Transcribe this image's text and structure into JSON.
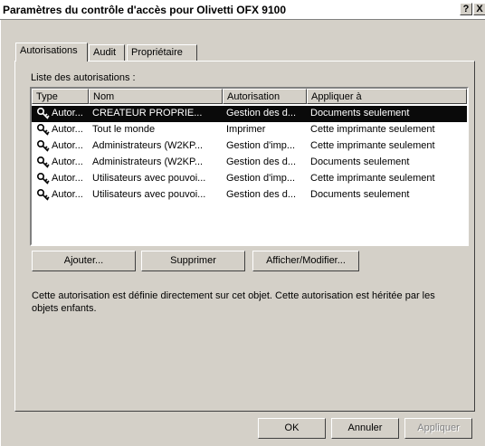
{
  "window": {
    "title_prefix": "Paramètres du contrôle d'accès pour",
    "printer_name": "Olivetti OFX 9100",
    "help_glyph": "?",
    "close_glyph": "X"
  },
  "tabs": [
    {
      "label": "Autorisations",
      "active": true
    },
    {
      "label": "Audit",
      "active": false
    },
    {
      "label": "Propriétaire",
      "active": false
    }
  ],
  "list": {
    "label": "Liste des autorisations :",
    "columns": [
      "Type",
      "Nom",
      "Autorisation",
      "Appliquer à"
    ],
    "rows": [
      {
        "type": "Autor...",
        "name": "CREATEUR PROPRIE...",
        "permission": "Gestion des d...",
        "apply_to": "Documents seulement",
        "selected": true
      },
      {
        "type": "Autor...",
        "name": "Tout le monde",
        "permission": "Imprimer",
        "apply_to": "Cette imprimante seulement",
        "selected": false
      },
      {
        "type": "Autor...",
        "name": "Administrateurs (W2KP...",
        "permission": "Gestion d'imp...",
        "apply_to": "Cette imprimante seulement",
        "selected": false
      },
      {
        "type": "Autor...",
        "name": "Administrateurs (W2KP...",
        "permission": "Gestion des d...",
        "apply_to": "Documents seulement",
        "selected": false
      },
      {
        "type": "Autor...",
        "name": "Utilisateurs avec pouvoi...",
        "permission": "Gestion d'imp...",
        "apply_to": "Cette imprimante seulement",
        "selected": false
      },
      {
        "type": "Autor...",
        "name": "Utilisateurs avec pouvoi...",
        "permission": "Gestion des d...",
        "apply_to": "Documents seulement",
        "selected": false
      }
    ],
    "icon": "key-icon"
  },
  "actions": {
    "add": "Ajouter...",
    "remove": "Supprimer",
    "view_edit": "Afficher/Modifier..."
  },
  "description": "Cette autorisation est définie directement sur cet objet. Cette autorisation est héritée par les objets enfants.",
  "footer": {
    "ok": "OK",
    "cancel": "Annuler",
    "apply": "Appliquer"
  },
  "colors": {
    "face": "#d4d0c8",
    "selection": "#0a0a0a",
    "disabled_text": "#808080"
  }
}
